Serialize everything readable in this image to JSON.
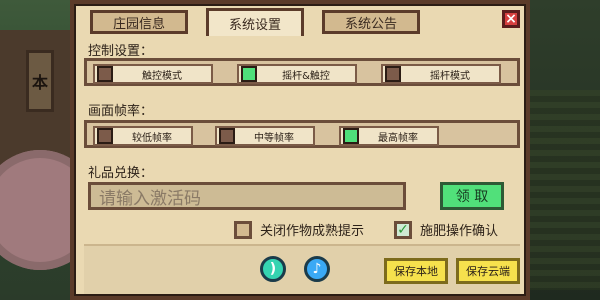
{
  "background": {
    "sign_text": "本"
  },
  "dialog": {
    "tabs": [
      {
        "label": "庄园信息"
      },
      {
        "label": "系统设置"
      },
      {
        "label": "系统公告"
      }
    ],
    "close_glyph": "×",
    "controls": {
      "title": "控制设置：",
      "options": [
        {
          "label": "触控模式",
          "selected": false
        },
        {
          "label": "摇杆&触控",
          "selected": true
        },
        {
          "label": "摇杆模式",
          "selected": false
        }
      ]
    },
    "framerate": {
      "title": "画面帧率：",
      "options": [
        {
          "label": "较低帧率",
          "selected": false
        },
        {
          "label": "中等帧率",
          "selected": false
        },
        {
          "label": "最高帧率",
          "selected": true
        }
      ]
    },
    "gift": {
      "title": "礼品兑换：",
      "placeholder": "请输入激活码",
      "redeem_label": "领 取"
    },
    "toggles": [
      {
        "label": "关闭作物成熟提示",
        "checked": false
      },
      {
        "label": "施肥操作确认",
        "checked": true
      }
    ],
    "bottom": {
      "sound_icon": "sound-icon",
      "music_icon": "music-icon",
      "save_local_label": "保存本地",
      "save_cloud_label": "保存云端"
    }
  }
}
